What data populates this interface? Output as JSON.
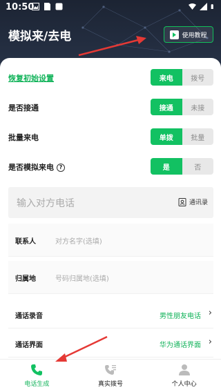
{
  "status_bar": {
    "time": "10:50"
  },
  "header": {
    "title": "模拟来/去电",
    "tutorial_label": "使用教程"
  },
  "settings": {
    "reset_label": "恢复初始设置",
    "call_type": {
      "options": [
        "来电",
        "拨号"
      ],
      "selected": "来电"
    },
    "answer": {
      "label": "是否接通",
      "options": [
        "接通",
        "未接"
      ],
      "selected": "接通"
    },
    "batch": {
      "label": "批量来电",
      "options": [
        "单拨",
        "批量"
      ],
      "selected": "单拨"
    },
    "simulate": {
      "label": "是否模拟来电",
      "help": "?",
      "options": [
        "是",
        "否"
      ],
      "selected": "是"
    }
  },
  "phone_input": {
    "placeholder": "输入对方电话",
    "contacts_label": "通讯录"
  },
  "fields": [
    {
      "label": "联系人",
      "placeholder": "对方名字(选填)"
    },
    {
      "label": "归属地",
      "placeholder": "号码归属地(选填)"
    }
  ],
  "options_rows": [
    {
      "label": "通话录音",
      "value": "男性朋友电话"
    },
    {
      "label": "通话界面",
      "value": "华为通话界面"
    }
  ],
  "tabbar": {
    "tabs": [
      {
        "label": "电话生成",
        "icon": "phone-icon",
        "active": true
      },
      {
        "label": "真实拨号",
        "icon": "dialpad-phone-icon",
        "active": false
      },
      {
        "label": "个人中心",
        "icon": "person-icon",
        "active": false
      }
    ]
  },
  "colors": {
    "accent": "#12c162",
    "header_bg": "#1c2433",
    "arrow": "#e53935"
  }
}
